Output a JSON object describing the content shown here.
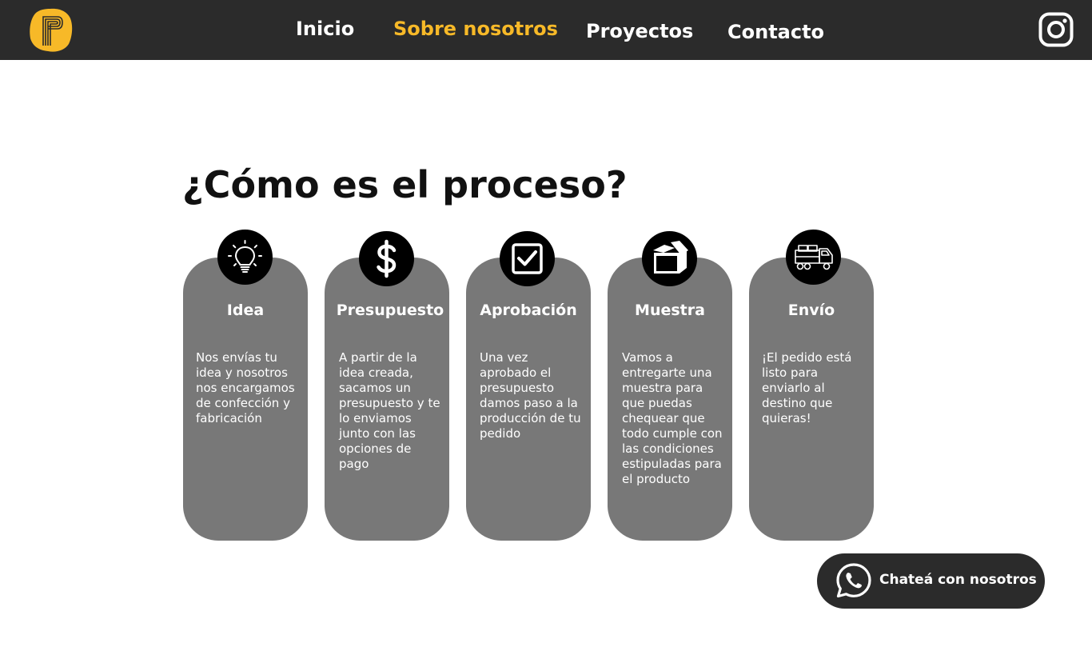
{
  "nav": {
    "logo_icon": "brand-logo-p",
    "links": [
      {
        "label": "Inicio"
      },
      {
        "label": "Sobre nosotros",
        "active": true
      },
      {
        "label": "Proyectos"
      },
      {
        "label": "Contacto"
      }
    ],
    "social_icon": "instagram-icon",
    "active_color": "#f7b928"
  },
  "section": {
    "title": "¿Cómo es el proceso?"
  },
  "steps": [
    {
      "icon": "lightbulb-icon",
      "title": "Idea",
      "text": "Nos envías tu idea y nosotros nos encargamos de confección y fabricación"
    },
    {
      "icon": "dollar-icon",
      "title": "Presupuesto",
      "text": "A partir de la idea creada, sacamos un presupuesto y te lo enviamos junto con las opciones de pago"
    },
    {
      "icon": "checkbox-icon",
      "title": "Aprobación",
      "text": "Una vez aprobado el presupuesto damos paso a la producción de tu pedido"
    },
    {
      "icon": "box-icon",
      "title": "Muestra",
      "text": "Vamos a entregarte una muestra para que puedas chequear que todo cumple con las condiciones estipuladas para el producto"
    },
    {
      "icon": "truck-icon",
      "title": "Envío",
      "text": "¡El pedido está listo para enviarlo al destino que quieras!"
    }
  ],
  "chat": {
    "icon": "whatsapp-icon",
    "label": "Chateá con nosotros"
  },
  "colors": {
    "navbar": "#2b2b2b",
    "card": "#787878",
    "accent": "#f7b928"
  }
}
